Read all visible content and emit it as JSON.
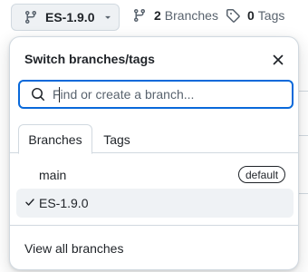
{
  "header": {
    "branch_selector_label": "ES-1.9.0",
    "branches_count": "2",
    "branches_label": "Branches",
    "tags_count": "0",
    "tags_label": "Tags"
  },
  "panel": {
    "title": "Switch branches/tags",
    "search_placeholder": "Find or create a branch...",
    "tabs": [
      {
        "label": "Branches",
        "active": true
      },
      {
        "label": "Tags",
        "active": false
      }
    ],
    "branches": [
      {
        "name": "main",
        "badge": "default",
        "selected": false
      },
      {
        "name": "ES-1.9.0",
        "badge": "",
        "selected": true
      }
    ],
    "footer_link": "View all branches"
  },
  "colors": {
    "accent": "#0969da",
    "text": "#1f2328",
    "muted": "#59636e",
    "border": "#d1d9e0",
    "selected_row": "#eff2f5"
  },
  "icons": [
    "git-branch-icon",
    "chevron-down-icon",
    "tag-icon",
    "close-icon",
    "search-icon",
    "check-icon"
  ]
}
